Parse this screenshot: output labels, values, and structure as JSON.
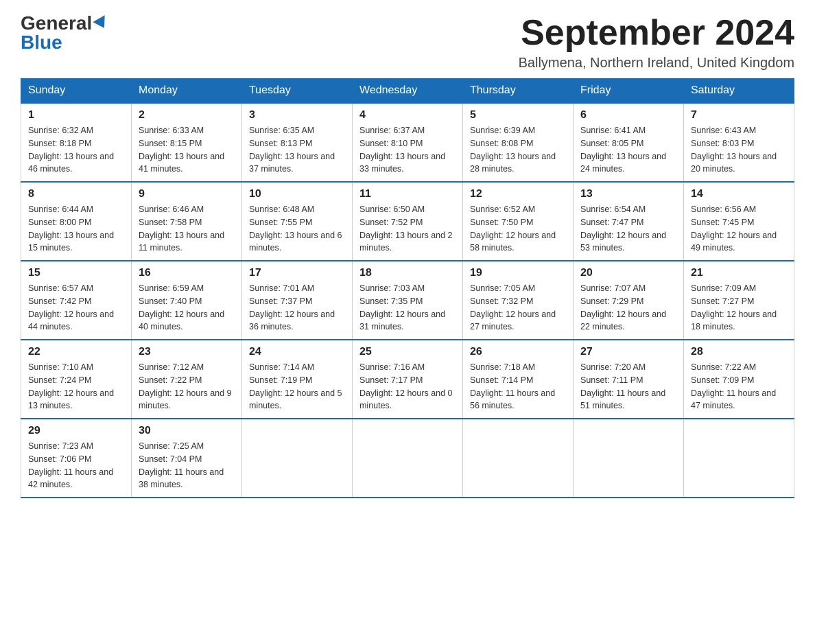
{
  "header": {
    "logo_general": "General",
    "logo_blue": "Blue",
    "month_title": "September 2024",
    "location": "Ballymena, Northern Ireland, United Kingdom"
  },
  "days_of_week": [
    "Sunday",
    "Monday",
    "Tuesday",
    "Wednesday",
    "Thursday",
    "Friday",
    "Saturday"
  ],
  "weeks": [
    [
      {
        "day": "1",
        "sunrise": "6:32 AM",
        "sunset": "8:18 PM",
        "daylight": "13 hours and 46 minutes."
      },
      {
        "day": "2",
        "sunrise": "6:33 AM",
        "sunset": "8:15 PM",
        "daylight": "13 hours and 41 minutes."
      },
      {
        "day": "3",
        "sunrise": "6:35 AM",
        "sunset": "8:13 PM",
        "daylight": "13 hours and 37 minutes."
      },
      {
        "day": "4",
        "sunrise": "6:37 AM",
        "sunset": "8:10 PM",
        "daylight": "13 hours and 33 minutes."
      },
      {
        "day": "5",
        "sunrise": "6:39 AM",
        "sunset": "8:08 PM",
        "daylight": "13 hours and 28 minutes."
      },
      {
        "day": "6",
        "sunrise": "6:41 AM",
        "sunset": "8:05 PM",
        "daylight": "13 hours and 24 minutes."
      },
      {
        "day": "7",
        "sunrise": "6:43 AM",
        "sunset": "8:03 PM",
        "daylight": "13 hours and 20 minutes."
      }
    ],
    [
      {
        "day": "8",
        "sunrise": "6:44 AM",
        "sunset": "8:00 PM",
        "daylight": "13 hours and 15 minutes."
      },
      {
        "day": "9",
        "sunrise": "6:46 AM",
        "sunset": "7:58 PM",
        "daylight": "13 hours and 11 minutes."
      },
      {
        "day": "10",
        "sunrise": "6:48 AM",
        "sunset": "7:55 PM",
        "daylight": "13 hours and 6 minutes."
      },
      {
        "day": "11",
        "sunrise": "6:50 AM",
        "sunset": "7:52 PM",
        "daylight": "13 hours and 2 minutes."
      },
      {
        "day": "12",
        "sunrise": "6:52 AM",
        "sunset": "7:50 PM",
        "daylight": "12 hours and 58 minutes."
      },
      {
        "day": "13",
        "sunrise": "6:54 AM",
        "sunset": "7:47 PM",
        "daylight": "12 hours and 53 minutes."
      },
      {
        "day": "14",
        "sunrise": "6:56 AM",
        "sunset": "7:45 PM",
        "daylight": "12 hours and 49 minutes."
      }
    ],
    [
      {
        "day": "15",
        "sunrise": "6:57 AM",
        "sunset": "7:42 PM",
        "daylight": "12 hours and 44 minutes."
      },
      {
        "day": "16",
        "sunrise": "6:59 AM",
        "sunset": "7:40 PM",
        "daylight": "12 hours and 40 minutes."
      },
      {
        "day": "17",
        "sunrise": "7:01 AM",
        "sunset": "7:37 PM",
        "daylight": "12 hours and 36 minutes."
      },
      {
        "day": "18",
        "sunrise": "7:03 AM",
        "sunset": "7:35 PM",
        "daylight": "12 hours and 31 minutes."
      },
      {
        "day": "19",
        "sunrise": "7:05 AM",
        "sunset": "7:32 PM",
        "daylight": "12 hours and 27 minutes."
      },
      {
        "day": "20",
        "sunrise": "7:07 AM",
        "sunset": "7:29 PM",
        "daylight": "12 hours and 22 minutes."
      },
      {
        "day": "21",
        "sunrise": "7:09 AM",
        "sunset": "7:27 PM",
        "daylight": "12 hours and 18 minutes."
      }
    ],
    [
      {
        "day": "22",
        "sunrise": "7:10 AM",
        "sunset": "7:24 PM",
        "daylight": "12 hours and 13 minutes."
      },
      {
        "day": "23",
        "sunrise": "7:12 AM",
        "sunset": "7:22 PM",
        "daylight": "12 hours and 9 minutes."
      },
      {
        "day": "24",
        "sunrise": "7:14 AM",
        "sunset": "7:19 PM",
        "daylight": "12 hours and 5 minutes."
      },
      {
        "day": "25",
        "sunrise": "7:16 AM",
        "sunset": "7:17 PM",
        "daylight": "12 hours and 0 minutes."
      },
      {
        "day": "26",
        "sunrise": "7:18 AM",
        "sunset": "7:14 PM",
        "daylight": "11 hours and 56 minutes."
      },
      {
        "day": "27",
        "sunrise": "7:20 AM",
        "sunset": "7:11 PM",
        "daylight": "11 hours and 51 minutes."
      },
      {
        "day": "28",
        "sunrise": "7:22 AM",
        "sunset": "7:09 PM",
        "daylight": "11 hours and 47 minutes."
      }
    ],
    [
      {
        "day": "29",
        "sunrise": "7:23 AM",
        "sunset": "7:06 PM",
        "daylight": "11 hours and 42 minutes."
      },
      {
        "day": "30",
        "sunrise": "7:25 AM",
        "sunset": "7:04 PM",
        "daylight": "11 hours and 38 minutes."
      },
      null,
      null,
      null,
      null,
      null
    ]
  ]
}
